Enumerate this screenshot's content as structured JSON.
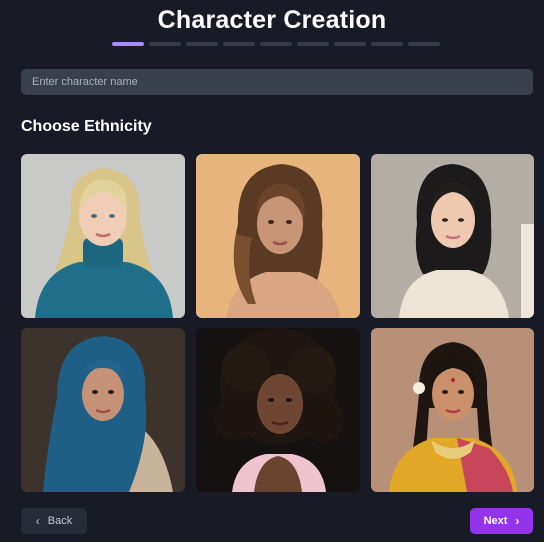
{
  "header": {
    "title": "Character Creation"
  },
  "progress": {
    "total_steps": 9,
    "current_step": 1,
    "accent": "#a78bfa"
  },
  "name_field": {
    "placeholder": "Enter character name",
    "value": ""
  },
  "section": {
    "title": "Choose Ethnicity"
  },
  "ethnicity_options": [
    {
      "icon": "portrait-blonde-woman"
    },
    {
      "icon": "portrait-brunette-woman"
    },
    {
      "icon": "portrait-east-asian-woman"
    },
    {
      "icon": "portrait-woman-blue-hijab"
    },
    {
      "icon": "portrait-woman-curly-hair"
    },
    {
      "icon": "portrait-woman-traditional-saree"
    }
  ],
  "footer": {
    "back_label": "Back",
    "next_label": "Next",
    "accent": "#9333ea"
  }
}
